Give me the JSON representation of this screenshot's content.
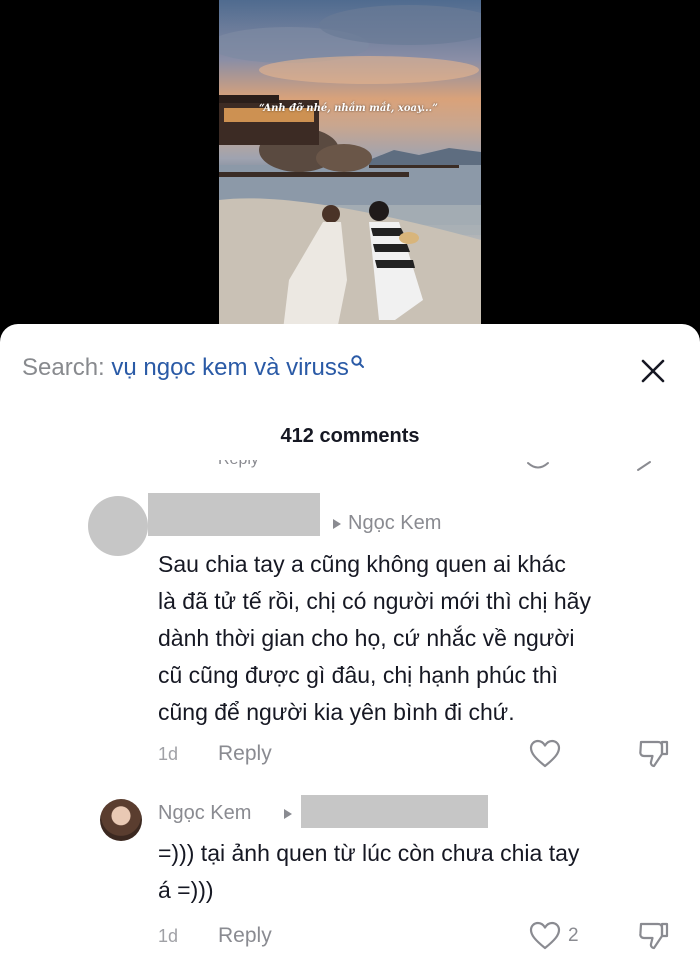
{
  "video": {
    "caption": "“Anh đỡ nhé, nhắm mắt, xoay...”"
  },
  "search": {
    "label": "Search:",
    "query": "vụ ngọc kem và viruss",
    "icon": "search-icon"
  },
  "close_icon": "close-icon",
  "comments_count": "412 comments",
  "partial_row": {
    "text": "Reply"
  },
  "comments": [
    {
      "reply_to": "Ngọc Kem",
      "lines": [
        "Sau chia tay a cũng không quen ai khác",
        "là đã tử tế rồi, chị có người mới thì chị hãy",
        "dành thời gian cho họ, cứ nhắc về người",
        "cũ cũng được gì đâu, chị hạnh phúc thì",
        "cũng để người kia yên bình đi chứ."
      ],
      "time": "1d",
      "reply_label": "Reply",
      "like_icon": "heart-outline-icon",
      "dislike_icon": "thumbs-down-icon"
    },
    {
      "author": "Ngọc Kem",
      "lines": [
        "=))) tại ảnh quen từ lúc còn chưa chia tay",
        "á =)))"
      ],
      "time": "1d",
      "reply_label": "Reply",
      "likes": "2",
      "like_icon": "heart-outline-icon",
      "dislike_icon": "thumbs-down-icon"
    }
  ],
  "colors": {
    "query": "#2a5aa6",
    "muted": "#8a8b91",
    "text": "#161823",
    "redaction": "#c6c6c6"
  }
}
